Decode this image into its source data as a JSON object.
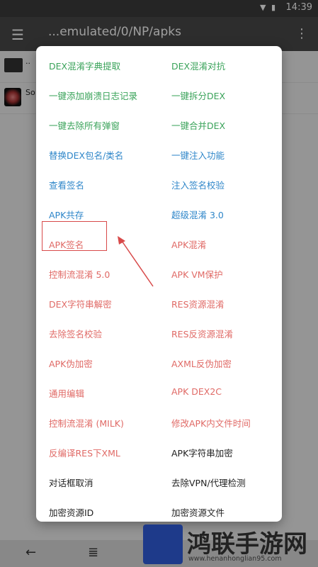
{
  "status_bar": {
    "time": "14:39",
    "icons": "▼ ▮"
  },
  "app_bar": {
    "menu_icon": "menu-icon",
    "title": "...emulated/0/NP/apks",
    "subtitle": "",
    "more_icon": "more-vert-icon"
  },
  "file_list": {
    "rows": [
      {
        "text": "..",
        "icon": "folder-icon"
      },
      {
        "text": "So",
        "icon": "apk-icon"
      }
    ]
  },
  "dialog": {
    "items": [
      {
        "label": "DEX混淆字典提取",
        "color": "green"
      },
      {
        "label": "DEX混淆对抗",
        "color": "green"
      },
      {
        "label": "一键添加崩溃日志记录",
        "color": "green"
      },
      {
        "label": "一键拆分DEX",
        "color": "green"
      },
      {
        "label": "一键去除所有弹窗",
        "color": "green"
      },
      {
        "label": "一键合并DEX",
        "color": "green"
      },
      {
        "label": "替换DEX包名/类名",
        "color": "blue"
      },
      {
        "label": "一键注入功能",
        "color": "blue"
      },
      {
        "label": "查看签名",
        "color": "blue"
      },
      {
        "label": "注入签名校验",
        "color": "blue"
      },
      {
        "label": "APK共存",
        "color": "blue"
      },
      {
        "label": "超级混淆 3.0",
        "color": "blue"
      },
      {
        "label": "APK签名",
        "color": "red"
      },
      {
        "label": "APK混淆",
        "color": "red"
      },
      {
        "label": "控制流混淆 5.0",
        "color": "red"
      },
      {
        "label": "APK VM保护",
        "color": "red"
      },
      {
        "label": "DEX字符串解密",
        "color": "red"
      },
      {
        "label": "RES资源混淆",
        "color": "red"
      },
      {
        "label": "去除签名校验",
        "color": "red"
      },
      {
        "label": "RES反资源混淆",
        "color": "red"
      },
      {
        "label": "APK伪加密",
        "color": "red"
      },
      {
        "label": "AXML反伪加密",
        "color": "red"
      },
      {
        "label": "通用编辑",
        "color": "red"
      },
      {
        "label": "APK DEX2C",
        "color": "red"
      },
      {
        "label": "控制流混淆 (MILK)",
        "color": "red"
      },
      {
        "label": "修改APK内文件时间",
        "color": "red"
      },
      {
        "label": "反编译RES下XML",
        "color": "red"
      },
      {
        "label": "APK字符串加密",
        "color": "black"
      },
      {
        "label": "对话框取消",
        "color": "black"
      },
      {
        "label": "去除VPN/代理检测",
        "color": "black"
      },
      {
        "label": "加密资源ID",
        "color": "black"
      },
      {
        "label": "加密资源文件",
        "color": "black"
      }
    ]
  },
  "bottom_bar": {
    "back_icon": "back-arrow-icon",
    "list_icon": "list-icon"
  },
  "watermark": {
    "text": "鸿联手游网",
    "url": "www.henanhonglian95.com"
  },
  "colors": {
    "green": "#3aa35a",
    "blue": "#2e86c9",
    "red": "#e06a66",
    "black": "#222222",
    "highlight": "#d84a4a"
  }
}
